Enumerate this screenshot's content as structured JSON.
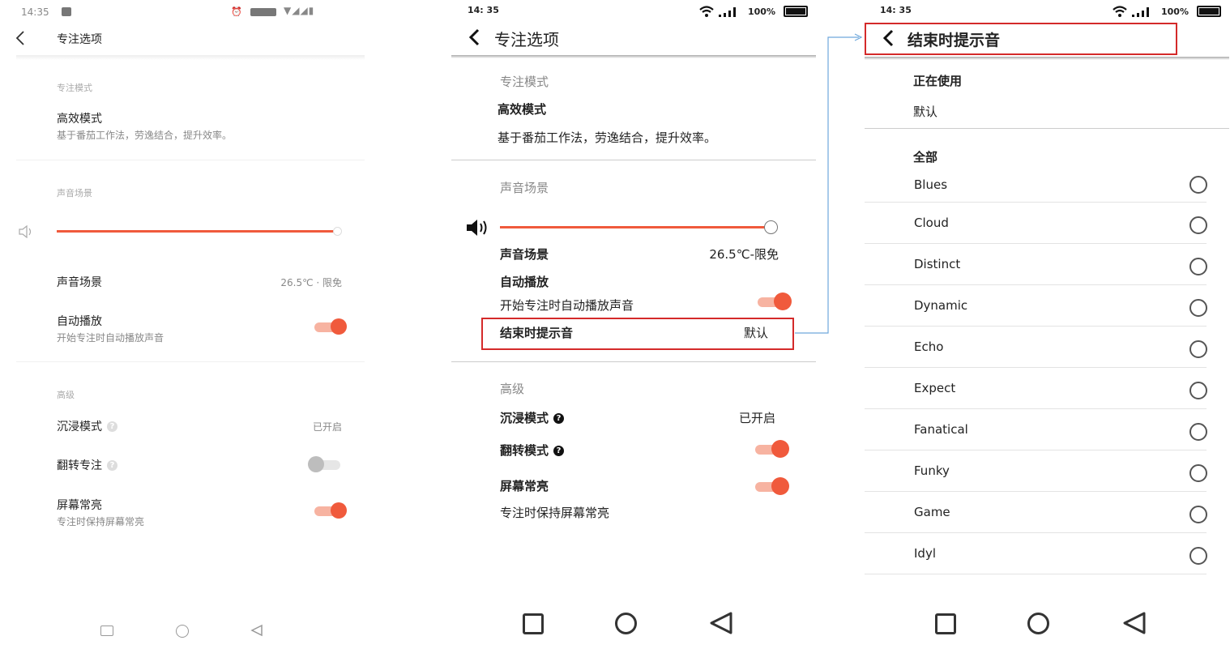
{
  "s1": {
    "time": "14:35",
    "title": "专注选项",
    "sec_focus": "专注模式",
    "efficient_title": "高效模式",
    "efficient_desc": "基于番茄工作法，劳逸结合，提升效率。",
    "sec_sound": "声音场景",
    "volume": 1.0,
    "sound_scene_label": "声音场景",
    "sound_scene_value": "26.5℃ · 限免",
    "autoplay_title": "自动播放",
    "autoplay_desc": "开始专注时自动播放声音",
    "autoplay_on": true,
    "sec_adv": "高级",
    "immersive_label": "沉浸模式",
    "immersive_value": "已开启",
    "flip_label": "翻转专注",
    "flip_on": false,
    "screen_title": "屏幕常亮",
    "screen_desc": "专注时保持屏幕常亮",
    "screen_on": true
  },
  "s2": {
    "time": "14: 35",
    "battery": "100%",
    "title": "专注选项",
    "sec_focus": "专注模式",
    "efficient_title": "高效模式",
    "efficient_desc": "基于番茄工作法，劳逸结合，提升效率。",
    "sec_sound": "声音场景",
    "volume": 1.0,
    "sound_scene_label": "声音场景",
    "sound_scene_value": "26.5℃-限免",
    "autoplay_title": "自动播放",
    "autoplay_desc": "开始专注时自动播放声音",
    "autoplay_on": true,
    "end_tone_label": "结束时提示音",
    "end_tone_value": "默认",
    "sec_adv": "高级",
    "immersive_label": "沉浸模式",
    "immersive_value": "已开启",
    "flip_label": "翻转模式",
    "flip_on": true,
    "screen_title": "屏幕常亮",
    "screen_desc": "专注时保持屏幕常亮",
    "screen_on": true
  },
  "s3": {
    "time": "14: 35",
    "battery": "100%",
    "title": "结束时提示音",
    "in_use_title": "正在使用",
    "in_use_value": "默认",
    "all_title": "全部",
    "tones": [
      {
        "label": "Blues"
      },
      {
        "label": "Cloud"
      },
      {
        "label": "Distinct"
      },
      {
        "label": "Dynamic"
      },
      {
        "label": "Echo"
      },
      {
        "label": "Expect"
      },
      {
        "label": "Fanatical"
      },
      {
        "label": "Funky"
      },
      {
        "label": "Game"
      },
      {
        "label": "Idyl"
      }
    ]
  },
  "icons": {
    "back": "chevron-left-icon",
    "volume": "volume-icon",
    "nav_square": "recent-apps-icon",
    "nav_circle": "home-icon",
    "nav_triangle": "back-icon"
  },
  "colors": {
    "accent": "#f05a3c",
    "highlight_box": "#d42a2a",
    "connector": "#6fa8dc"
  }
}
